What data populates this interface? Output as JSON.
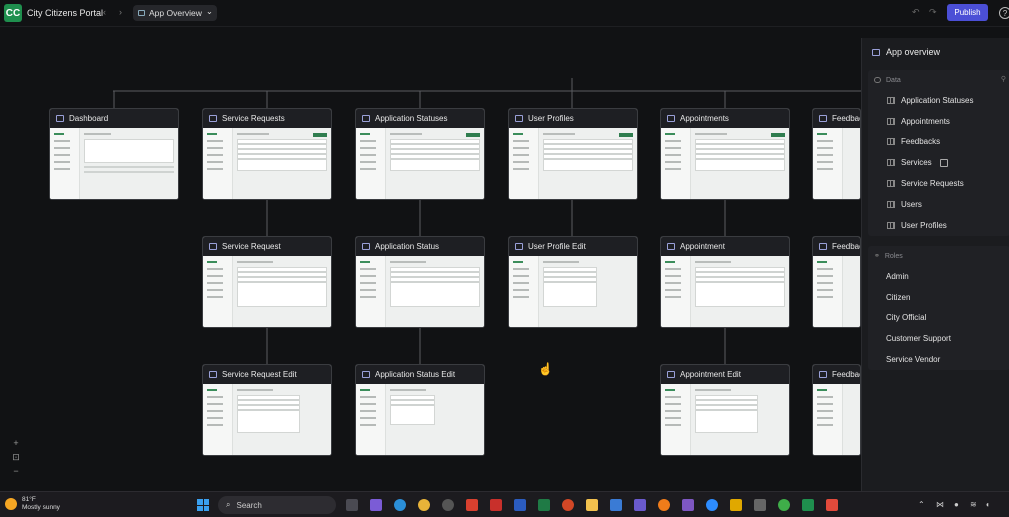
{
  "header": {
    "logo_text": "CC",
    "app_title": "City Citizens Portal",
    "back_arrow": "‹",
    "forward_arrow": "›",
    "view_label": "App Overview",
    "view_chevron": "⌄",
    "undo_glyph": "↶",
    "redo_glyph": "↷",
    "publish_label": "Publish",
    "help_glyph": "?"
  },
  "canvas": {
    "cards": [
      {
        "title": "Dashboard"
      },
      {
        "title": "Service Requests"
      },
      {
        "title": "Application Statuses"
      },
      {
        "title": "User Profiles"
      },
      {
        "title": "Appointments"
      },
      {
        "title": "Feedbac"
      },
      {
        "title": "Service Request"
      },
      {
        "title": "Application Status"
      },
      {
        "title": "User Profile Edit"
      },
      {
        "title": "Appointment"
      },
      {
        "title": "Feedbac"
      },
      {
        "title": "Service Request Edit"
      },
      {
        "title": "Application Status Edit"
      },
      {
        "title": "Appointment Edit"
      },
      {
        "title": "Feedbac"
      }
    ],
    "zoom_in": "+",
    "fit": "⊡",
    "zoom_out": "−"
  },
  "panel": {
    "title": "App overview",
    "data_label": "Data",
    "data_items": [
      {
        "label": "Application Statuses"
      },
      {
        "label": "Appointments"
      },
      {
        "label": "Feedbacks"
      },
      {
        "label": "Services"
      },
      {
        "label": "Service Requests"
      },
      {
        "label": "Users"
      },
      {
        "label": "User Profiles"
      }
    ],
    "roles_label": "Roles",
    "roles": [
      {
        "label": "Admin"
      },
      {
        "label": "Citizen"
      },
      {
        "label": "City Official"
      },
      {
        "label": "Customer Support"
      },
      {
        "label": "Service Vendor"
      }
    ]
  },
  "taskbar": {
    "temperature": "81°F",
    "weather": "Mostly sunny",
    "search_label": "Search",
    "colors": {
      "accent": "#4b4fd6",
      "brand": "#1f8f4e"
    }
  }
}
